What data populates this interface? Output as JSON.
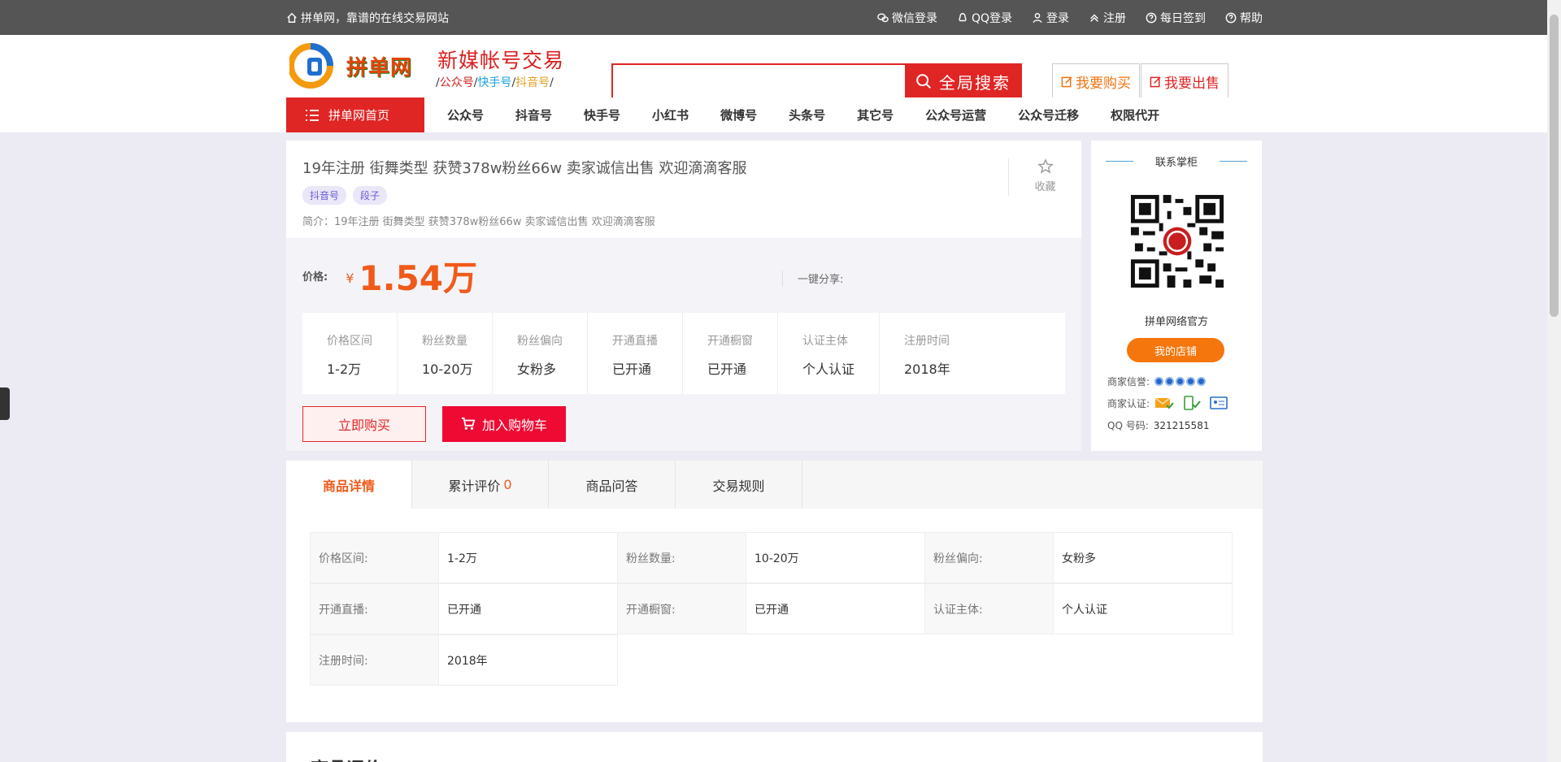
{
  "topbar": {
    "welcome": "拼单网，靠谱的在线交易网站",
    "wechat_login": "微信登录",
    "qq_login": "QQ登录",
    "login": "登录",
    "register": "注册",
    "checkin": "每日签到",
    "help": "帮助"
  },
  "header": {
    "logo_text": "拼单网",
    "slogan": "新媒帐号交易",
    "sub1": "公众号",
    "sub2": "快手号",
    "sub3": "抖音号",
    "search_placeholder": "",
    "search_button": "全局搜索",
    "buy_button": "我要购买",
    "sell_button": "我要出售"
  },
  "nav": {
    "home": "拼单网首页",
    "items": [
      "公众号",
      "抖音号",
      "快手号",
      "小红书",
      "微博号",
      "头条号",
      "其它号",
      "公众号运营",
      "公众号迁移",
      "权限代开"
    ]
  },
  "product": {
    "title": "19年注册 街舞类型 获赞378w粉丝66w 卖家诚信出售 欢迎滴滴客服",
    "tags": [
      "抖音号",
      "段子"
    ],
    "intro": "简介：19年注册 街舞类型 获赞378w粉丝66w 卖家诚信出售 欢迎滴滴客服",
    "favorite": "收藏",
    "price_label": "价格:",
    "currency": "¥",
    "price": "1.54万",
    "share_label": "一键分享:",
    "attrs": [
      {
        "k": "价格区间",
        "v": "1-2万"
      },
      {
        "k": "粉丝数量",
        "v": "10-20万"
      },
      {
        "k": "粉丝偏向",
        "v": "女粉多"
      },
      {
        "k": "开通直播",
        "v": "已开通"
      },
      {
        "k": "开通橱窗",
        "v": "已开通"
      },
      {
        "k": "认证主体",
        "v": "个人认证"
      },
      {
        "k": "注册时间",
        "v": "2018年"
      }
    ],
    "buy_now": "立即购买",
    "add_cart": "加入购物车"
  },
  "seller": {
    "heading": "联系掌柜",
    "name": "拼单网络官方",
    "shop_button": "我的店铺",
    "credit_label": "商家信誉:",
    "cert_label": "商家认证:",
    "qq_label": "QQ 号码:",
    "qq_value": "321215581"
  },
  "tabs": [
    {
      "label": "商品详情",
      "count": ""
    },
    {
      "label": "累计评价",
      "count": "0"
    },
    {
      "label": "商品问答",
      "count": ""
    },
    {
      "label": "交易规则",
      "count": ""
    }
  ],
  "details": [
    [
      {
        "k": "价格区间:",
        "v": "1-2万"
      },
      {
        "k": "粉丝数量:",
        "v": "10-20万"
      },
      {
        "k": "粉丝偏向:",
        "v": "女粉多"
      }
    ],
    [
      {
        "k": "开通直播:",
        "v": "已开通"
      },
      {
        "k": "开通橱窗:",
        "v": "已开通"
      },
      {
        "k": "认证主体:",
        "v": "个人认证"
      }
    ],
    [
      {
        "k": "注册时间:",
        "v": "2018年"
      }
    ]
  ],
  "review_heading": "商品评价",
  "colors": {
    "accent": "#e02525",
    "orange": "#f05a1a",
    "topbar": "#555555"
  }
}
